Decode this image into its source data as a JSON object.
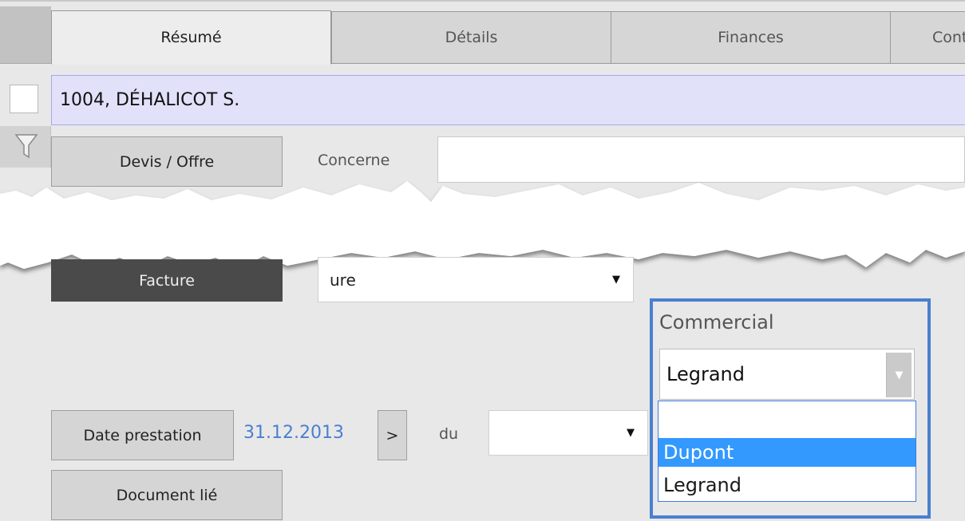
{
  "tabs": [
    {
      "label": "Résumé",
      "active": true
    },
    {
      "label": "Détails",
      "active": false
    },
    {
      "label": "Finances",
      "active": false
    },
    {
      "label": "Cont",
      "active": false
    }
  ],
  "client": {
    "name": "1004, DÉHALICOT S."
  },
  "filter_icon": "funnel-icon",
  "devis_button": "Devis / Offre",
  "concerne_label": "Concerne",
  "concerne_value": "",
  "facture_button": "Facture",
  "facture_select": {
    "value": "ure"
  },
  "commercial": {
    "label": "Commercial",
    "selected": "Legrand",
    "options": [
      "",
      "Dupont",
      "Legrand"
    ],
    "highlighted": "Dupont",
    "accent": "#4a7fd0",
    "highlight_color": "#3399ff"
  },
  "date_prestation": {
    "button": "Date prestation",
    "value": "31.12.2013",
    "next_button": ">",
    "du_label": "du",
    "du_value": ""
  },
  "document_lie_button": "Document lié"
}
